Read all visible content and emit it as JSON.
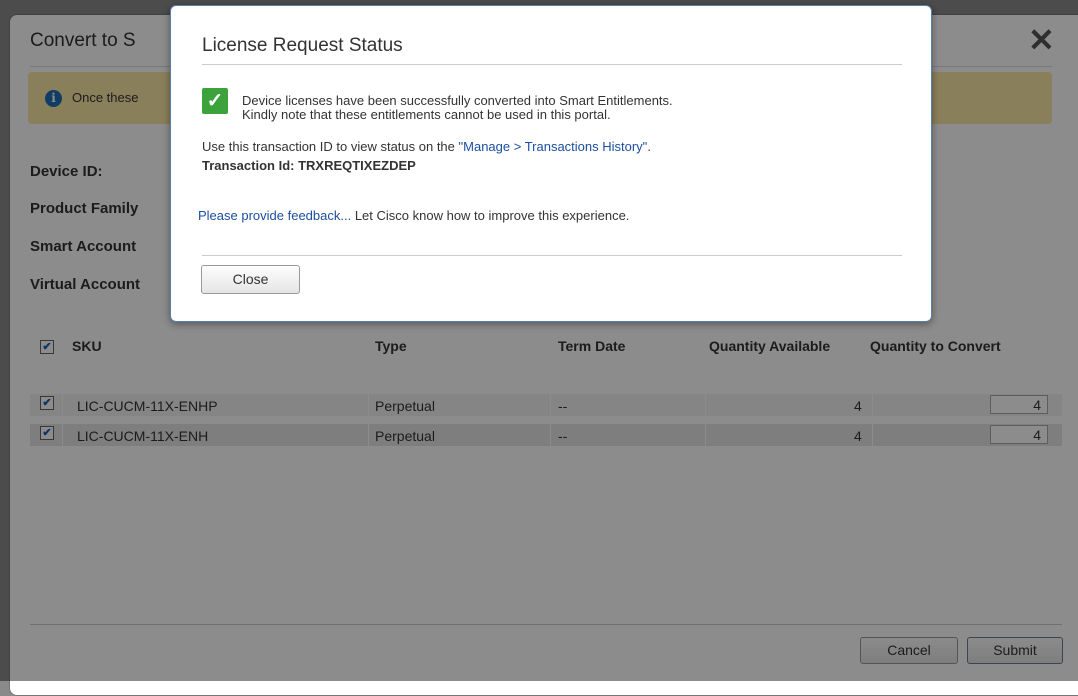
{
  "background_dialog": {
    "title": "Convert to S",
    "notice_text": "Once these",
    "fields": {
      "device_id": "Device ID:",
      "product_family": "Product Family",
      "smart_account": "Smart Account",
      "virtual_account": "Virtual Account"
    },
    "table": {
      "headers": [
        "SKU",
        "Type",
        "Term Date",
        "Quantity Available",
        "Quantity to Convert"
      ],
      "rows": [
        {
          "sku": "LIC-CUCM-11X-ENHP",
          "type": "Perpetual",
          "term_date": "--",
          "qty_available": "4",
          "qty_convert": "4",
          "checked": true
        },
        {
          "sku": "LIC-CUCM-11X-ENH",
          "type": "Perpetual",
          "term_date": "--",
          "qty_available": "4",
          "qty_convert": "4",
          "checked": true
        }
      ]
    },
    "buttons": {
      "cancel": "Cancel",
      "submit": "Submit"
    },
    "close_glyph": "✕"
  },
  "modal": {
    "title": "License Request Status",
    "success_line1": "Device licenses have been successfully converted into Smart Entitlements.",
    "success_line2": "Kindly note that these entitlements cannot be used in this portal.",
    "txn_prefix": "Use this transaction ID to view status on the ",
    "txn_link": "\"Manage > Transactions History\"",
    "txn_suffix": ".",
    "txn_id": "Transaction Id: TRXREQTIXEZDEP",
    "feedback_link": "Please provide feedback...",
    "feedback_text": " Let Cisco know how to improve this experience.",
    "close_button": "Close"
  },
  "colors": {
    "success": "#3ca33c",
    "link": "#1c4fa1",
    "notice": "#fce7a6",
    "info": "#1f6fb8"
  }
}
